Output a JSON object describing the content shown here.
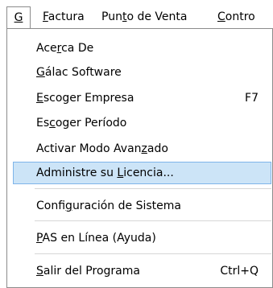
{
  "menubar": {
    "items": [
      {
        "pre": "",
        "mn": "G",
        "post": ""
      },
      {
        "pre": "",
        "mn": "F",
        "post": "actura"
      },
      {
        "pre": "Pun",
        "mn": "t",
        "post": "o de Venta"
      },
      {
        "pre": "",
        "mn": "C",
        "post": "ontro"
      }
    ]
  },
  "menu": {
    "items": [
      {
        "pre": "Ace",
        "mn": "r",
        "post": "ca De",
        "shortcut": ""
      },
      {
        "pre": "",
        "mn": "G",
        "post": "álac Software",
        "shortcut": ""
      },
      {
        "pre": "",
        "mn": "E",
        "post": "scoger Empresa",
        "shortcut": "F7"
      },
      {
        "pre": "Es",
        "mn": "c",
        "post": "oger Período",
        "shortcut": ""
      },
      {
        "pre": "Activar Modo Avan",
        "mn": "z",
        "post": "ado",
        "shortcut": ""
      },
      {
        "pre": "Administre su ",
        "mn": "L",
        "post": "icencia...",
        "shortcut": ""
      },
      {
        "pre": "Confi",
        "mn": "g",
        "post": "uración de Sistema",
        "shortcut": ""
      },
      {
        "pre": "",
        "mn": "P",
        "post": "AS en Línea (Ayuda)",
        "shortcut": ""
      },
      {
        "pre": "",
        "mn": "S",
        "post": "alir del Programa",
        "shortcut": "Ctrl+Q"
      }
    ]
  }
}
